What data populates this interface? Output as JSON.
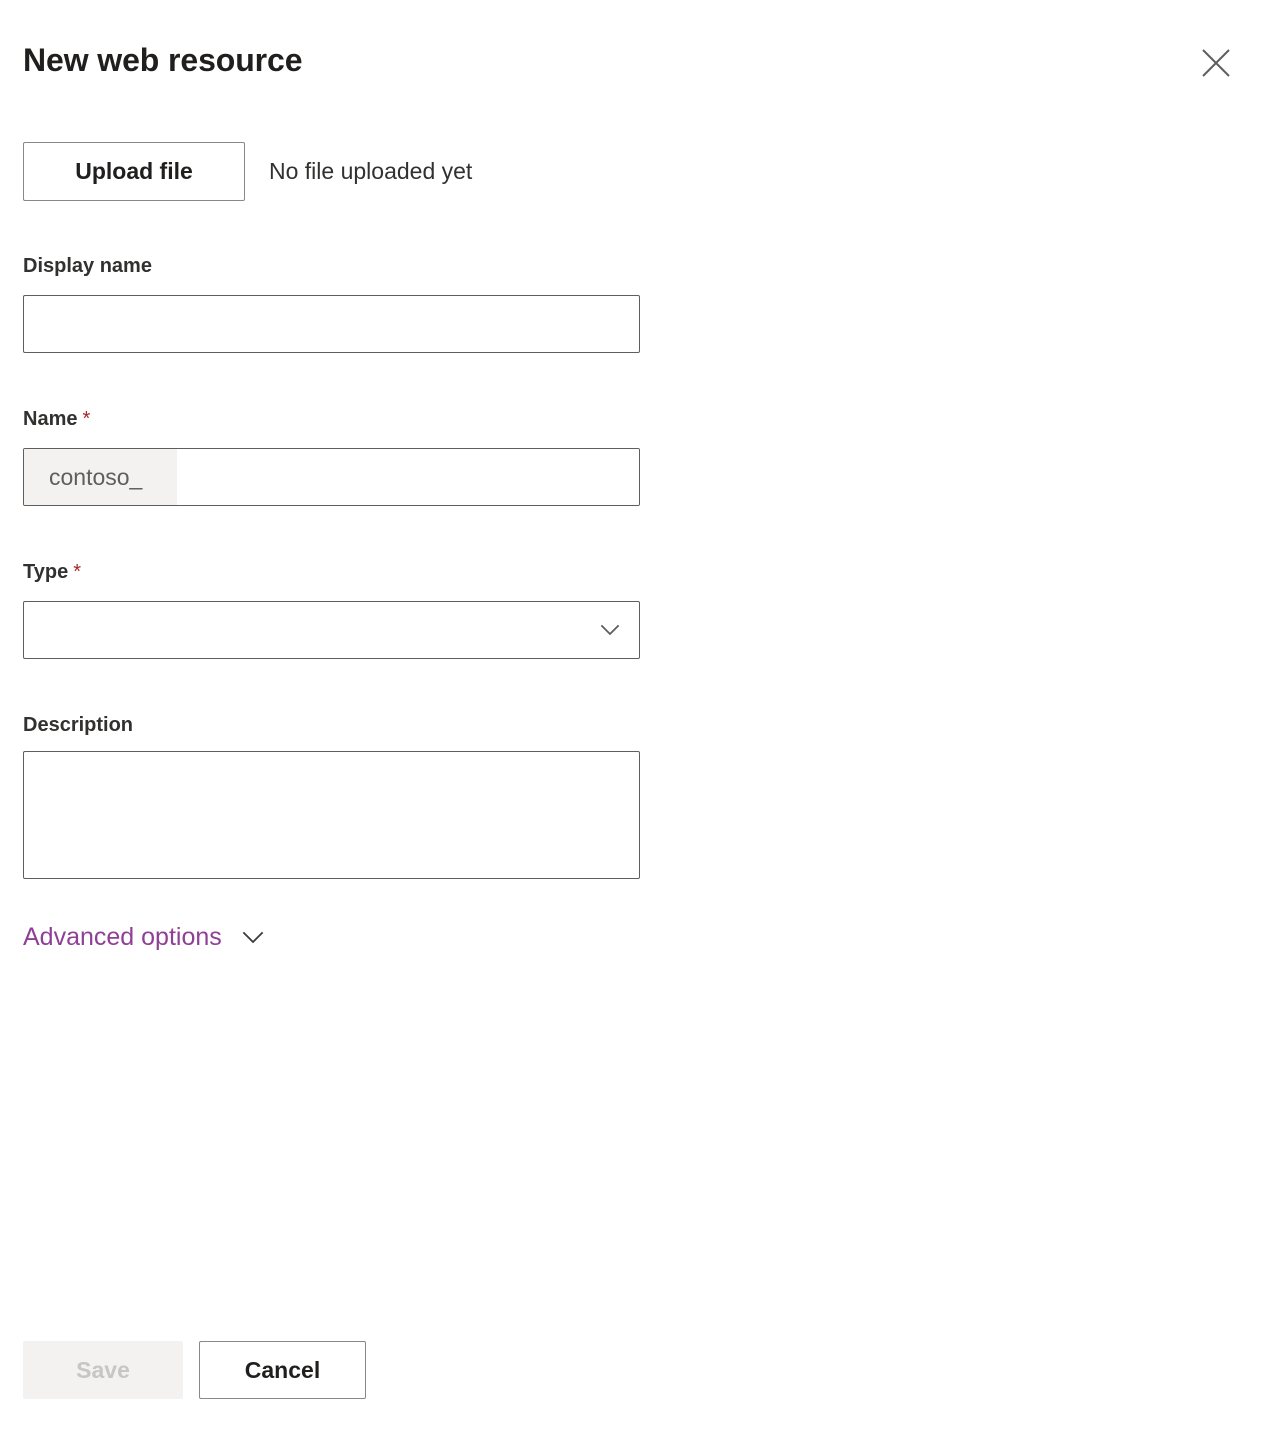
{
  "panel": {
    "title": "New web resource",
    "close_icon": "close-icon"
  },
  "upload": {
    "button_label": "Upload file",
    "status_text": "No file uploaded yet"
  },
  "fields": {
    "display_name": {
      "label": "Display name",
      "value": "",
      "placeholder": ""
    },
    "name": {
      "label": "Name",
      "required_marker": "*",
      "prefix": "contoso_",
      "value": "",
      "placeholder": ""
    },
    "type": {
      "label": "Type",
      "required_marker": "*",
      "value": "",
      "chevron_icon": "chevron-down-icon"
    },
    "description": {
      "label": "Description",
      "value": "",
      "placeholder": ""
    }
  },
  "advanced_options": {
    "label": "Advanced options",
    "chevron_icon": "chevron-down-icon"
  },
  "footer": {
    "save_label": "Save",
    "cancel_label": "Cancel"
  },
  "colors": {
    "accent_purple": "#8f3f96",
    "required_red": "#a4262c",
    "text_primary": "#201f1e",
    "text_secondary": "#605e5c",
    "border": "#605e5c",
    "button_border": "#8a8886",
    "disabled_bg": "#f3f2f1",
    "disabled_text": "#c8c6c4",
    "prefix_bg": "#f3f2f1"
  }
}
